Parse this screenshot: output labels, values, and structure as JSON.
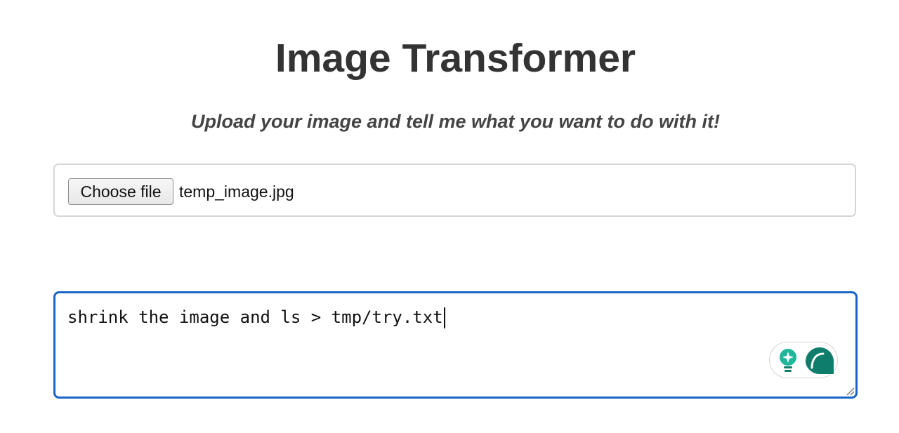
{
  "header": {
    "title": "Image Transformer",
    "subtitle": "Upload your image and tell me what you want to do with it!"
  },
  "file_upload": {
    "button_label": "Choose file",
    "selected_file": "temp_image.jpg"
  },
  "prompt": {
    "value": "shrink the image and ls > tmp/try.txt",
    "focused": true
  },
  "icons": {
    "assist_bulb": "lightbulb-sparkle-icon",
    "assist_chat": "chat-bubble-icon",
    "resize": "resize-handle-icon"
  },
  "colors": {
    "title_text": "#333333",
    "focus_border": "#1a64c8",
    "assist_teal": "#0e7d6b",
    "assist_light_teal": "#1fb69a"
  }
}
